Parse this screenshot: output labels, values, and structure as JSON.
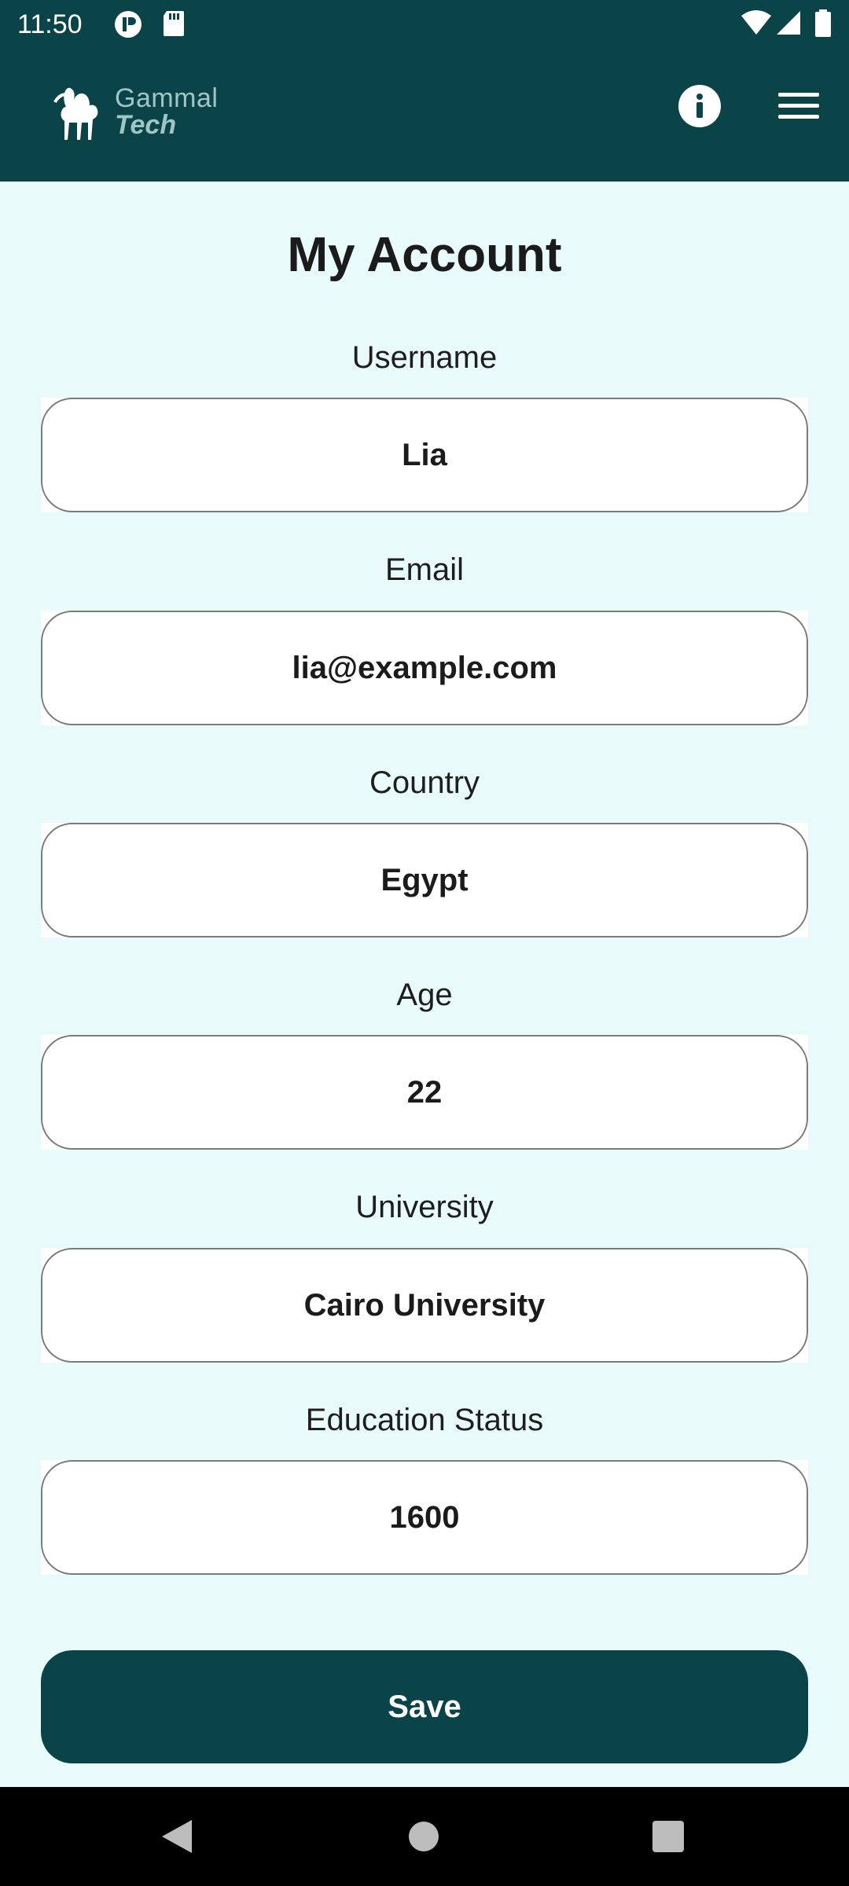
{
  "status_bar": {
    "time": "11:50"
  },
  "app_bar": {
    "logo_word1": "Gammal",
    "logo_word2": "Tech",
    "info_icon": "info-icon",
    "menu_icon": "hamburger-menu-icon"
  },
  "page": {
    "title": "My Account"
  },
  "fields": [
    {
      "label": "Username",
      "value": "Lia"
    },
    {
      "label": "Email",
      "value": "lia@example.com"
    },
    {
      "label": "Country",
      "value": "Egypt"
    },
    {
      "label": "Age",
      "value": "22"
    },
    {
      "label": "University",
      "value": "Cairo University"
    },
    {
      "label": "Education Status",
      "value": "1600"
    }
  ],
  "save_button": {
    "label": "Save"
  },
  "colors": {
    "primary": "#0B4448",
    "background": "#E9FAFA",
    "field_border": "#7B7B7B"
  }
}
